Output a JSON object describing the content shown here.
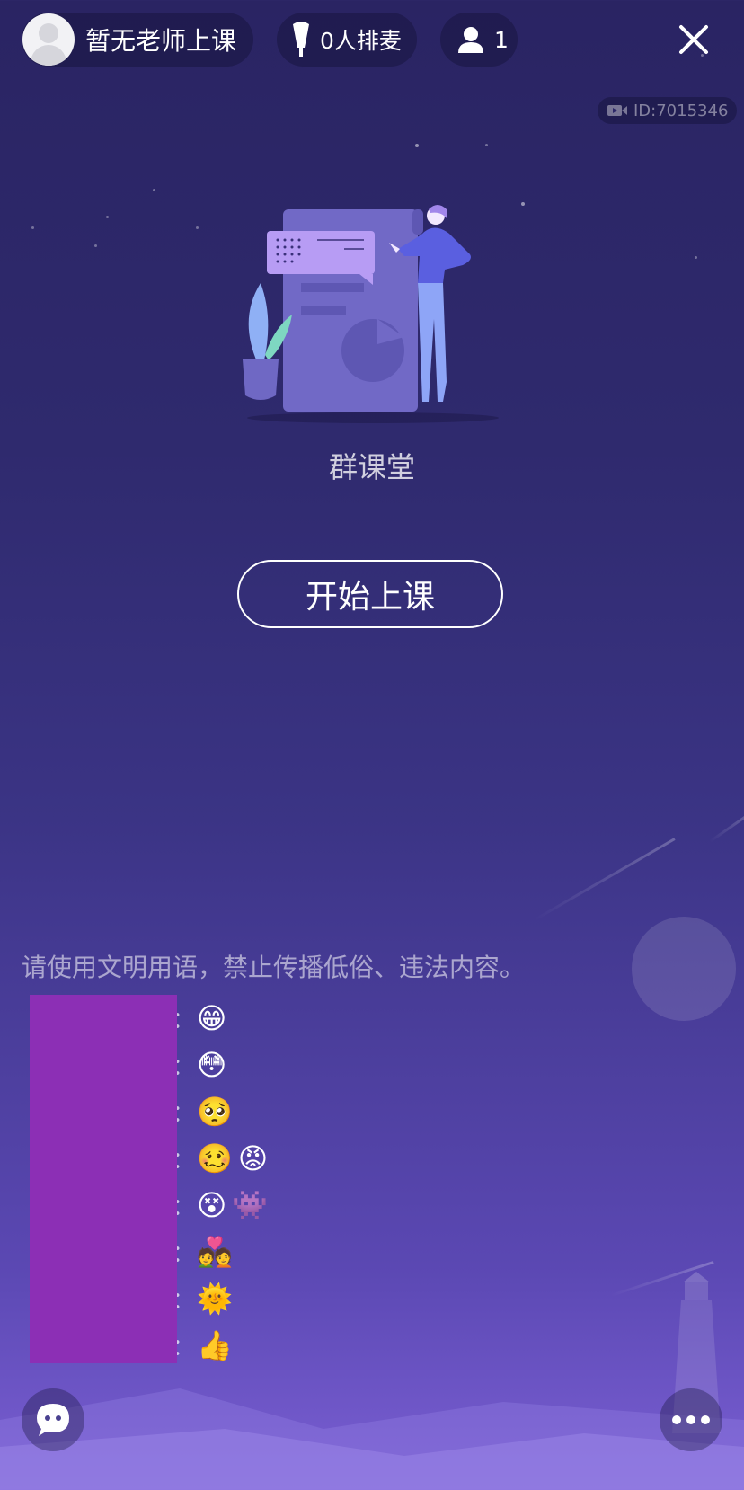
{
  "header": {
    "teacher_status": "暂无老师上课",
    "mic_queue": "0人排麦",
    "audience_count": "1"
  },
  "room": {
    "id_label": "ID:7015346"
  },
  "main": {
    "title": "群课堂",
    "start_button": "开始上课"
  },
  "chat": {
    "notice": "请使用文明用语，禁止传播低俗、违法内容。",
    "messages": [
      {
        "emojis": [
          "😁"
        ]
      },
      {
        "emojis": [
          "😳"
        ]
      },
      {
        "emojis": [
          "🥺"
        ]
      },
      {
        "emojis": [
          "🥴",
          "😡"
        ]
      },
      {
        "emojis": [
          "😵",
          "👾"
        ]
      },
      {
        "emojis": [
          "💑"
        ]
      },
      {
        "emojis": [
          "🌞"
        ]
      },
      {
        "emojis": [
          "👍"
        ]
      }
    ],
    "colon": "："
  },
  "colors": {
    "background_top": "#2a2463",
    "background_bottom": "#7a5fd3",
    "name_mask": "#8c2fb5"
  },
  "icons": [
    "avatar",
    "microphone-icon",
    "user-icon",
    "close-icon",
    "video-icon",
    "chat-icon",
    "more-icon"
  ]
}
